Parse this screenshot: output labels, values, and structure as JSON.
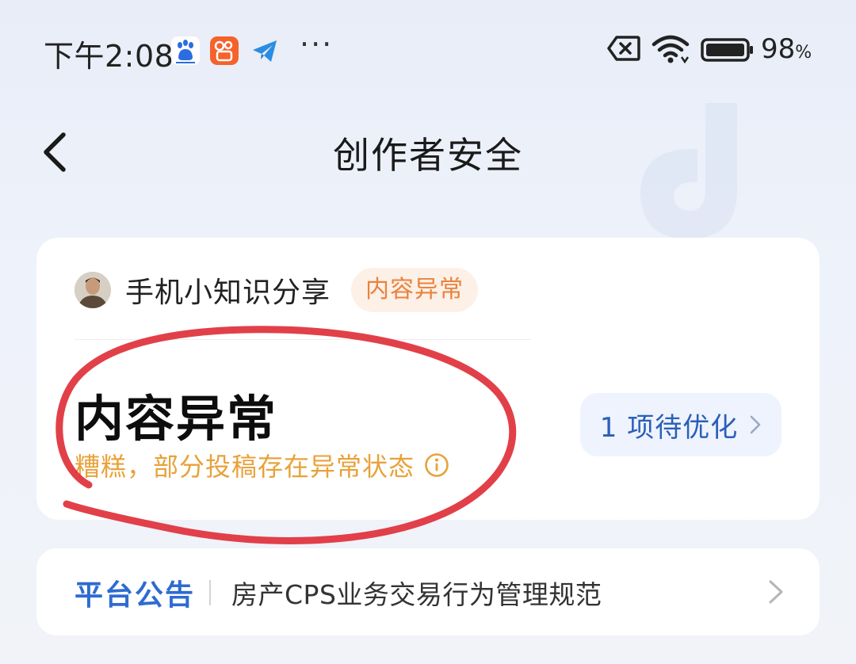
{
  "status_bar": {
    "time": "下午2:08",
    "battery_percent": "98",
    "battery_unit": "%",
    "notification_icons": [
      "baidu-app-icon",
      "kuaishou-app-icon",
      "telegram-app-icon"
    ],
    "overflow": "···",
    "system_icons": [
      "sim-off-icon",
      "wifi-icon",
      "battery-icon"
    ]
  },
  "header": {
    "title": "创作者安全",
    "back_icon": "chevron-left-icon"
  },
  "card": {
    "account_name": "手机小知识分享",
    "badge": "内容异常",
    "heading": "内容异常",
    "message": "糟糕，部分投稿存在异常状态",
    "info_icon": "info-icon",
    "action_label": "1 项待优化",
    "action_icon": "chevron-right-icon"
  },
  "announcement": {
    "label": "平台公告",
    "text": "房产CPS业务交易行为管理规范",
    "icon": "chevron-right-icon"
  },
  "colors": {
    "warning": "#e9833f",
    "warning_text": "#e8a23a",
    "primary": "#2e6bd1",
    "annotation_red": "#e0303a"
  }
}
